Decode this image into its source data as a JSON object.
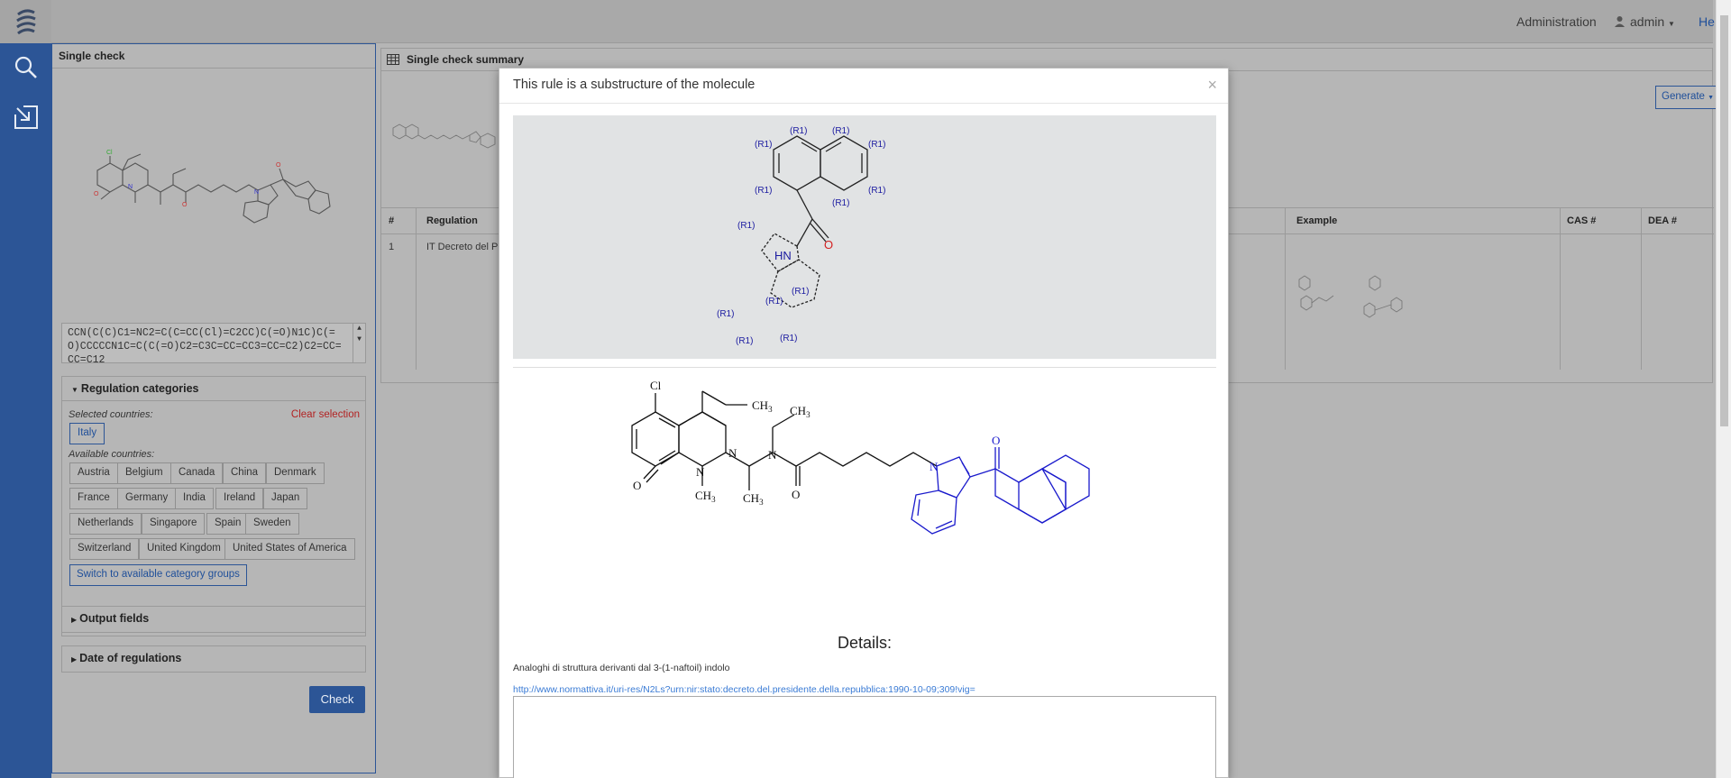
{
  "topbar": {
    "administration": "Administration",
    "user": "admin",
    "help": "He"
  },
  "left_panel": {
    "title": "Single check",
    "smiles": "CCN(C(C)C1=NC2=C(C=CC(Cl)=C2CC)C(=O)N1C)C(=O)CCCCCN1C=C(C(=O)C2=C3C=CC=CC3=CC=C2)C2=CC=CC=C12",
    "regulation": {
      "title": "Regulation categories",
      "selected_label": "Selected countries:",
      "clear_label": "Clear selection",
      "selected": [
        "Italy"
      ],
      "available_label": "Available countries:",
      "available": [
        "Austria",
        "Belgium",
        "Canada",
        "China",
        "Denmark",
        "France",
        "Germany",
        "India",
        "Ireland",
        "Japan",
        "Netherlands",
        "Singapore",
        "Spain",
        "Sweden",
        "Switzerland",
        "United Kingdom",
        "United States of America"
      ],
      "switch_label": "Switch to available category groups"
    },
    "output_fields": "Output fields",
    "date_of_regulations": "Date of regulations",
    "check_button": "Check"
  },
  "summary": {
    "title": "Single check summary",
    "generate_label": "Generate",
    "columns": [
      "#",
      "Regulation",
      "Example",
      "CAS #",
      "DEA #"
    ],
    "rows": [
      {
        "num": "1",
        "regulation": "IT Decreto del Pre"
      }
    ]
  },
  "modal": {
    "title": "This rule is a substructure of the molecule",
    "close": "×",
    "rule_labels": {
      "r": "(R1)",
      "hn": "HN",
      "o": "O"
    },
    "molecule_labels": {
      "cl": "Cl",
      "n": "N",
      "o": "O",
      "ch3": "CH",
      "sub3": "3"
    },
    "details_title": "Details:",
    "details_desc": "Analoghi di struttura derivanti dal 3-(1-naftoil) indolo",
    "details_link": "http://www.normattiva.it/uri-res/N2Ls?urn:nir:stato:decreto.del.presidente.della.repubblica:1990-10-09;309!vig="
  }
}
